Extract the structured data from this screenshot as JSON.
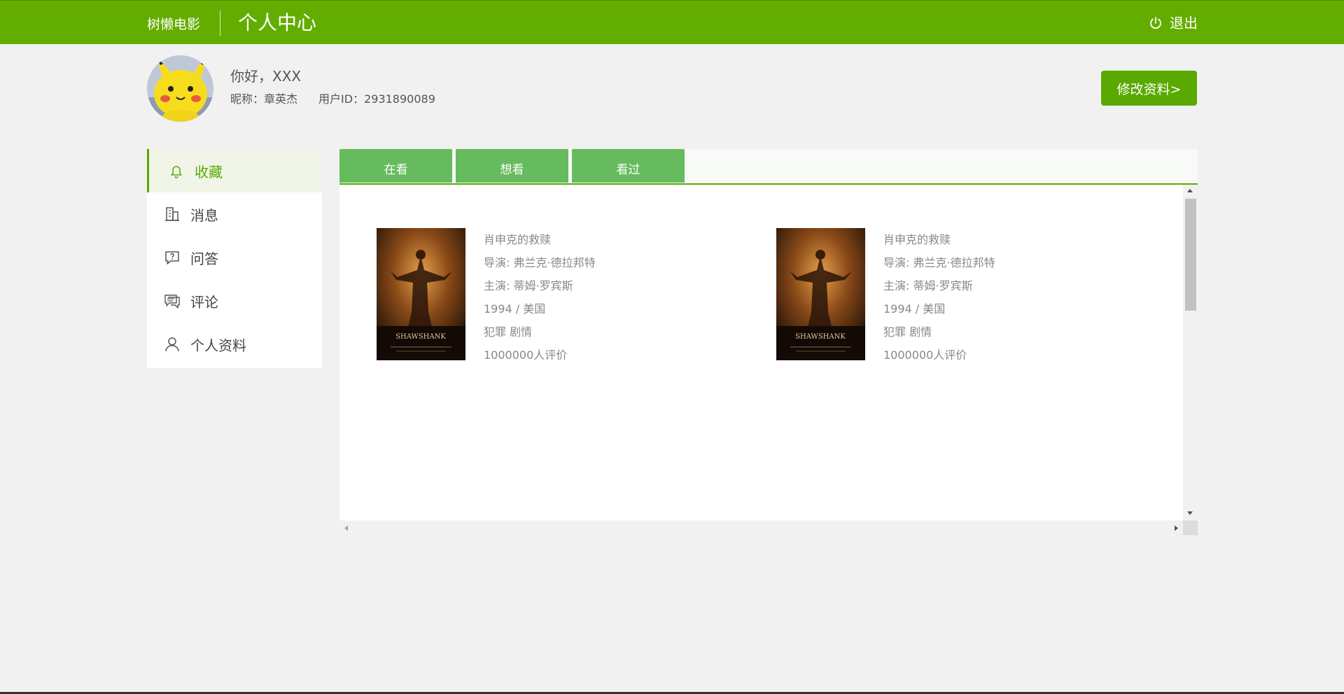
{
  "header": {
    "brand": "树懒电影",
    "title": "个人中心",
    "logout_label": "退出",
    "bg_color": "#63ad00"
  },
  "profile": {
    "greeting": "你好，XXX",
    "nickname_label": "昵称：",
    "nickname": "章英杰",
    "userid_label": "用户ID：",
    "userid": "2931890089",
    "edit_button": "修改资料>"
  },
  "sidebar": {
    "items": [
      {
        "label": "收藏",
        "icon": "bell-icon",
        "active": true
      },
      {
        "label": "消息",
        "icon": "building-icon",
        "active": false
      },
      {
        "label": "问答",
        "icon": "question-icon",
        "active": false
      },
      {
        "label": "评论",
        "icon": "comment-icon",
        "active": false
      },
      {
        "label": "个人资料",
        "icon": "user-icon",
        "active": false
      }
    ]
  },
  "tabs": [
    {
      "label": "在看"
    },
    {
      "label": "想看"
    },
    {
      "label": "看过"
    }
  ],
  "movies": [
    {
      "title": "肖申克的救赎",
      "director": "导演: 弗兰克·德拉邦特",
      "actors": "主演: 蒂姆·罗宾斯",
      "year_country": "1994 / 美国",
      "genres": "犯罪 剧情",
      "ratings": "1000000人评价",
      "poster_text": "SHAWSHANK"
    },
    {
      "title": "肖申克的救赎",
      "director": "导演: 弗兰克·德拉邦特",
      "actors": "主演: 蒂姆·罗宾斯",
      "year_country": "1994 / 美国",
      "genres": "犯罪 剧情",
      "ratings": "1000000人评价",
      "poster_text": "SHAWSHANK"
    }
  ],
  "colors": {
    "accent": "#5aa900",
    "tab": "#66bb5e"
  }
}
